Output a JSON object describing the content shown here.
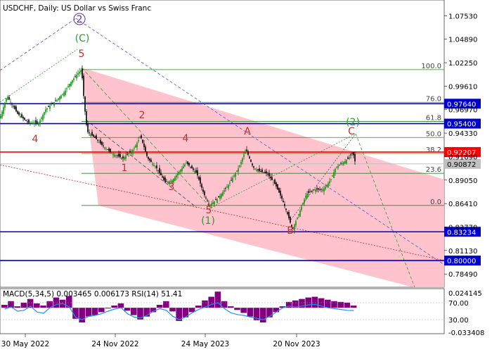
{
  "chart_data": [
    {
      "type": "line",
      "subtype": "candlestick",
      "title": "USDCHF, Daily:  US Dollar vs Swiss Franc",
      "price_axis_ticks": [
        "1.07530",
        "1.04890",
        "1.02250",
        "0.99610",
        "0.96970",
        "0.94330",
        "0.91690",
        "0.89050",
        "0.86410",
        "0.83770",
        "0.81130",
        "0.78490"
      ],
      "ylim": [
        0.77,
        1.093
      ],
      "date_axis_ticks": [
        "30 May 2022",
        "24 Nov 2022",
        "24 May 2023",
        "20 Nov 2023"
      ],
      "levels": [
        {
          "label": "0.97640",
          "value": 0.9764,
          "color": "#0000cc"
        },
        {
          "label": "0.95400",
          "value": 0.954,
          "color": "#0000cc"
        },
        {
          "label": "0.92207",
          "value": 0.92207,
          "color": "#ff0000"
        },
        {
          "label": "0.90872",
          "value": 0.90872,
          "color": "#c0c0c0"
        },
        {
          "label": "0.83234",
          "value": 0.83234,
          "color": "#0000cc"
        },
        {
          "label": "0.80000",
          "value": 0.8,
          "color": "#0000cc"
        }
      ],
      "fibonacci": [
        {
          "label": "100.0",
          "value": 1.0147
        },
        {
          "label": "76.0",
          "value": 0.978
        },
        {
          "label": "61.8",
          "value": 0.9564
        },
        {
          "label": "50.0",
          "value": 0.9384
        },
        {
          "label": "38.2",
          "value": 0.9204
        },
        {
          "label": "23.6",
          "value": 0.8981
        },
        {
          "label": "0.0",
          "value": 0.862
        }
      ],
      "wave_labels": [
        {
          "text": "2",
          "style": "circled",
          "color": "#663399"
        },
        {
          "text": "(C)",
          "color": "#339933"
        },
        {
          "text": "5",
          "color": "#c03030"
        },
        {
          "text": "4",
          "color": "#c03030"
        },
        {
          "text": "2",
          "color": "#c03030"
        },
        {
          "text": "4",
          "color": "#c03030"
        },
        {
          "text": "1",
          "color": "#c03030"
        },
        {
          "text": "3",
          "color": "#c03030"
        },
        {
          "text": "5",
          "color": "#c03030"
        },
        {
          "text": "(1)",
          "color": "#339933"
        },
        {
          "text": "A",
          "color": "#c03030"
        },
        {
          "text": "B",
          "color": "#c03030"
        },
        {
          "text": "C",
          "color": "#c03030"
        },
        {
          "text": "(2)",
          "color": "#339933"
        }
      ],
      "price_path": [
        [
          0,
          0.96
        ],
        [
          10,
          0.985
        ],
        [
          25,
          0.965
        ],
        [
          40,
          0.955
        ],
        [
          55,
          0.955
        ],
        [
          65,
          0.97
        ],
        [
          80,
          0.98
        ],
        [
          92,
          0.99
        ],
        [
          100,
          1.0
        ],
        [
          108,
          1.008
        ],
        [
          116,
          1.015
        ],
        [
          120,
          0.975
        ],
        [
          124,
          0.945
        ],
        [
          135,
          0.938
        ],
        [
          145,
          0.93
        ],
        [
          160,
          0.92
        ],
        [
          175,
          0.915
        ],
        [
          190,
          0.925
        ],
        [
          200,
          0.94
        ],
        [
          210,
          0.915
        ],
        [
          222,
          0.905
        ],
        [
          235,
          0.888
        ],
        [
          245,
          0.89
        ],
        [
          255,
          0.9
        ],
        [
          265,
          0.91
        ],
        [
          280,
          0.898
        ],
        [
          290,
          0.875
        ],
        [
          298,
          0.862
        ],
        [
          310,
          0.87
        ],
        [
          325,
          0.885
        ],
        [
          340,
          0.905
        ],
        [
          350,
          0.925
        ],
        [
          360,
          0.905
        ],
        [
          370,
          0.9
        ],
        [
          380,
          0.898
        ],
        [
          392,
          0.885
        ],
        [
          402,
          0.868
        ],
        [
          410,
          0.85
        ],
        [
          416,
          0.835
        ],
        [
          424,
          0.85
        ],
        [
          436,
          0.875
        ],
        [
          448,
          0.88
        ],
        [
          460,
          0.88
        ],
        [
          470,
          0.89
        ],
        [
          478,
          0.905
        ],
        [
          488,
          0.91
        ],
        [
          496,
          0.915
        ],
        [
          502,
          0.922
        ],
        [
          506,
          0.908
        ]
      ]
    },
    {
      "type": "bar",
      "title": "MACD(5,34,5) 0.003465 0.006173 RSI(14) 51.41",
      "axis_ticks": [
        "0.024145",
        "70.00",
        "30.00",
        "-0.033408"
      ],
      "ylim": [
        -0.033408,
        0.024145
      ],
      "series": [
        {
          "name": "MACD",
          "values": [
            0.004,
            0.009,
            0.002,
            0.007,
            0.012,
            0.006,
            0.003,
            0.009,
            0.014,
            0.011,
            0.016,
            -0.015,
            -0.02,
            -0.012,
            -0.01,
            -0.006,
            -0.001,
            0.003,
            0.006,
            -0.004,
            -0.01,
            -0.016,
            -0.012,
            -0.006,
            0.004,
            0.009,
            -0.005,
            -0.018,
            -0.013,
            -0.006,
            0.003,
            0.01,
            0.015,
            0.022,
            0.009,
            0.002,
            -0.003,
            -0.007,
            -0.012,
            -0.017,
            -0.02,
            -0.013,
            -0.006,
            0.002,
            0.008,
            0.01,
            0.012,
            0.014,
            0.015,
            0.013,
            0.011,
            0.009,
            0.008,
            0.007,
            0.003
          ]
        },
        {
          "name": "RSI(14)",
          "values": [
            55,
            60,
            50,
            52,
            62,
            48,
            45,
            58,
            66,
            68,
            60,
            35,
            30,
            38,
            40,
            44,
            50,
            55,
            58,
            44,
            36,
            34,
            40,
            50,
            56,
            52,
            38,
            30,
            36,
            46,
            54,
            60,
            66,
            70,
            56,
            46,
            42,
            40,
            36,
            33,
            30,
            38,
            48,
            58,
            62,
            60,
            62,
            65,
            66,
            62,
            58,
            56,
            54,
            52,
            51.41
          ]
        }
      ]
    }
  ]
}
